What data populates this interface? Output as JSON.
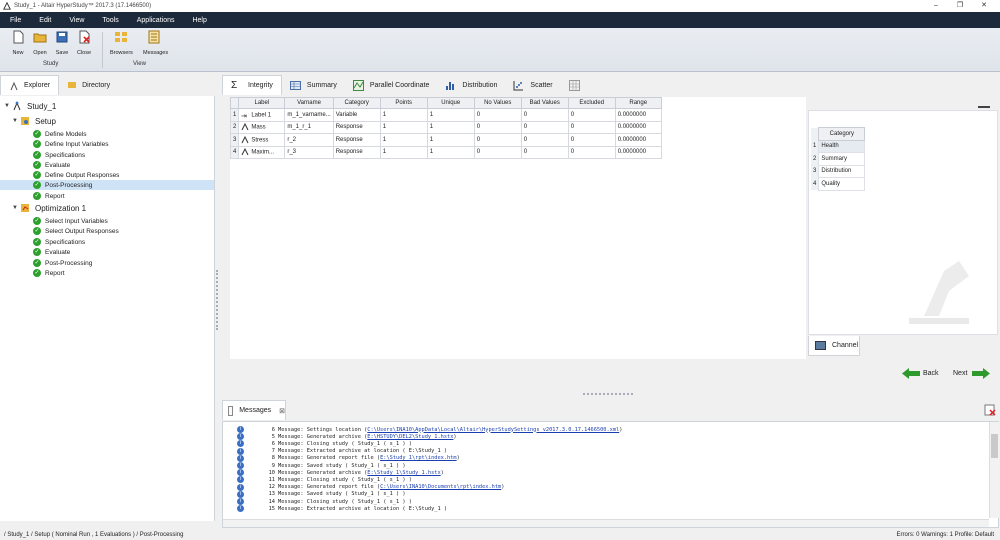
{
  "window": {
    "title": "Study_1 - Altair HyperStudy™ 2017.3 (17.1466500)"
  },
  "menu": [
    "File",
    "Edit",
    "View",
    "Tools",
    "Applications",
    "Help"
  ],
  "ribbon": {
    "study_buttons": [
      {
        "label": "New",
        "icon": "new-file-icon"
      },
      {
        "label": "Open",
        "icon": "open-folder-icon"
      },
      {
        "label": "Save",
        "icon": "save-disk-icon"
      },
      {
        "label": "Close",
        "icon": "close-file-icon"
      }
    ],
    "view_buttons": [
      {
        "label": "Browsers",
        "icon": "browsers-icon"
      },
      {
        "label": "Messages",
        "icon": "messages-icon"
      }
    ],
    "group_study": "Study",
    "group_view": "View"
  },
  "left_tabs": [
    "Explorer",
    "Directory"
  ],
  "tree": {
    "root": "Study_1",
    "setup": "Setup",
    "setup_items": [
      "Define Models",
      "Define Input Variables",
      "Specifications",
      "Evaluate",
      "Define Output Responses",
      "Post-Processing",
      "Report"
    ],
    "optimization": "Optimization 1",
    "opt_items": [
      "Select Input Variables",
      "Select Output Responses",
      "Specifications",
      "Evaluate",
      "Post-Processing",
      "Report"
    ]
  },
  "right_tabs": [
    "Integrity",
    "Summary",
    "Parallel Coordinate",
    "Distribution",
    "Scatter"
  ],
  "grid": {
    "headers": [
      "Label",
      "Varname",
      "Category",
      "Points",
      "Unique",
      "No Values",
      "Bad Values",
      "Excluded",
      "Range"
    ],
    "rows": [
      {
        "n": "1",
        "label": "Label 1",
        "varname": "m_1_varname...",
        "category": "Variable",
        "points": "1",
        "unique": "1",
        "no_values": "0",
        "bad_values": "0",
        "excluded": "0",
        "range": "0.0000000"
      },
      {
        "n": "2",
        "label": "Mass",
        "varname": "m_1_r_1",
        "category": "Response",
        "points": "1",
        "unique": "1",
        "no_values": "0",
        "bad_values": "0",
        "excluded": "0",
        "range": "0.0000000"
      },
      {
        "n": "3",
        "label": "Stress",
        "varname": "r_2",
        "category": "Response",
        "points": "1",
        "unique": "1",
        "no_values": "0",
        "bad_values": "0",
        "excluded": "0",
        "range": "0.0000000"
      },
      {
        "n": "4",
        "label": "Maxim...",
        "varname": "r_3",
        "category": "Response",
        "points": "1",
        "unique": "1",
        "no_values": "0",
        "bad_values": "0",
        "excluded": "0",
        "range": "0.0000000"
      }
    ]
  },
  "category_panel": {
    "header": "Category",
    "items": [
      {
        "n": "1",
        "name": "Health"
      },
      {
        "n": "2",
        "name": "Summary"
      },
      {
        "n": "3",
        "name": "Distribution"
      },
      {
        "n": "4",
        "name": "Quality"
      }
    ],
    "channel_tab": "Channel"
  },
  "nav": {
    "back": "Back",
    "next": "Next"
  },
  "messages": {
    "tab": "Messages",
    "lines": [
      {
        "num": "6",
        "text": "Message: Settings location ( ",
        "link": "C:\\Users\\INA10\\AppData\\Local\\Altair\\HyperStudySettings_v2017.3.0.17.1466500.xml",
        "tail": " )"
      },
      {
        "num": "5",
        "text": "Message: Generated archive ( ",
        "link": "E:\\HSTUDY\\DEL2\\Study_1.hstx",
        "tail": " )"
      },
      {
        "num": "6",
        "text": "Message: Closing study ( Study_1 ( s_1 ) )",
        "link": "",
        "tail": ""
      },
      {
        "num": "7",
        "text": "Message: Extracted archive at location ( E:\\Study_1 )",
        "link": "",
        "tail": ""
      },
      {
        "num": "8",
        "text": "Message: Generated report file ( ",
        "link": "E:\\Study_1\\rpt\\index.htm",
        "tail": " )"
      },
      {
        "num": "9",
        "text": "Message: Saved study ( Study_1 ( s_1 ) )",
        "link": "",
        "tail": ""
      },
      {
        "num": "10",
        "text": "Message: Generated archive ( ",
        "link": "E:\\Study_1\\Study_1.hstx",
        "tail": " )"
      },
      {
        "num": "11",
        "text": "Message: Closing study ( Study_1 ( s_1 ) )",
        "link": "",
        "tail": ""
      },
      {
        "num": "12",
        "text": "Message: Generated report file ( ",
        "link": "C:\\Users\\INA10\\Documents\\rpt\\index.htm",
        "tail": " )"
      },
      {
        "num": "13",
        "text": "Message: Saved study ( Study_1 ( s_1 ) )",
        "link": "",
        "tail": ""
      },
      {
        "num": "14",
        "text": "Message: Closing study ( Study_1 ( s_1 ) )",
        "link": "",
        "tail": ""
      },
      {
        "num": "15",
        "text": "Message: Extracted archive at location ( E:\\Study_1 )",
        "link": "",
        "tail": ""
      }
    ]
  },
  "status": {
    "path": "/ Study_1 / Setup ( Nominal Run , 1 Evaluations ) / Post-Processing",
    "right": "Errors: 0  Warnings: 1     Profile: Default"
  },
  "colors": {
    "menubar": "#1d2a3c",
    "check": "#2ca02c",
    "nav_arrow": "#2e9a2e",
    "link": "#1a3fb0"
  }
}
